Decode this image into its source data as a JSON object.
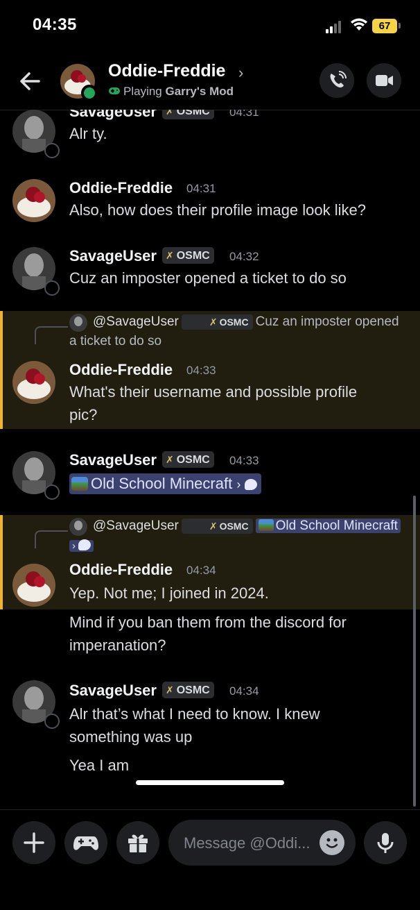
{
  "status": {
    "time": "04:35",
    "battery": "67"
  },
  "header": {
    "name": "Oddie-Freddie",
    "activity_prefix": "Playing",
    "activity_game": "Garry's Mod"
  },
  "users": {
    "savage": "SavageUser",
    "oddie": "Oddie-Freddie",
    "tag": "OSMC"
  },
  "messages": [
    {
      "author": "SavageUser",
      "time": "04:31",
      "text": "Alr ty."
    },
    {
      "author": "Oddie-Freddie",
      "time": "04:31",
      "text": "Also, how does their profile image look like?"
    },
    {
      "author": "SavageUser",
      "time": "04:32",
      "text": "Cuz an imposter opened a ticket to do so"
    },
    {
      "reply_to": "@SavageUser",
      "reply_snippet": "Cuz an imposter opened a ticket to do so",
      "author": "Oddie-Freddie",
      "time": "04:33",
      "text": "What's their username and possible profile pic?"
    },
    {
      "author": "SavageUser",
      "time": "04:33",
      "channel": "Old School Minecraft"
    },
    {
      "reply_to": "@SavageUser",
      "reply_channel": "Old School Minecraft",
      "author": "Oddie-Freddie",
      "time": "04:34",
      "text": "Yep. Not me; I joined in 2024.",
      "text2": "Mind if you ban them from the discord for imperanation?"
    },
    {
      "author": "SavageUser",
      "time": "04:34",
      "text": "Alr that’s what I need to know. I knew something was up",
      "text2": "Yea I am"
    }
  ],
  "composer": {
    "placeholder": "Message @Oddi..."
  },
  "colors": {
    "accent_yellow": "#f0b232",
    "online": "#23a55a",
    "mention_bg": "#3c4270"
  }
}
